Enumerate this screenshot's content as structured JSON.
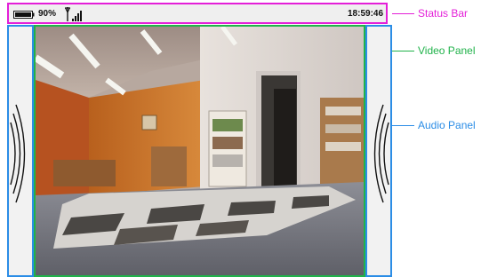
{
  "status_bar": {
    "battery_icon": "battery-icon",
    "battery_percent": "90%",
    "signal_icon": "antenna-signal-icon",
    "clock": "18:59:46"
  },
  "audio_panel": {
    "icon": "speaker-sound-wave-arcs"
  },
  "video_panel": {
    "content": "camera-feed-office-interior"
  },
  "callouts": {
    "status_bar": {
      "label": "Status Bar",
      "color": "#e41fd8"
    },
    "video_panel": {
      "label": "Video Panel",
      "color": "#20b24a"
    },
    "audio_panel": {
      "label": "Audio Panel",
      "color": "#2b8de6"
    }
  }
}
